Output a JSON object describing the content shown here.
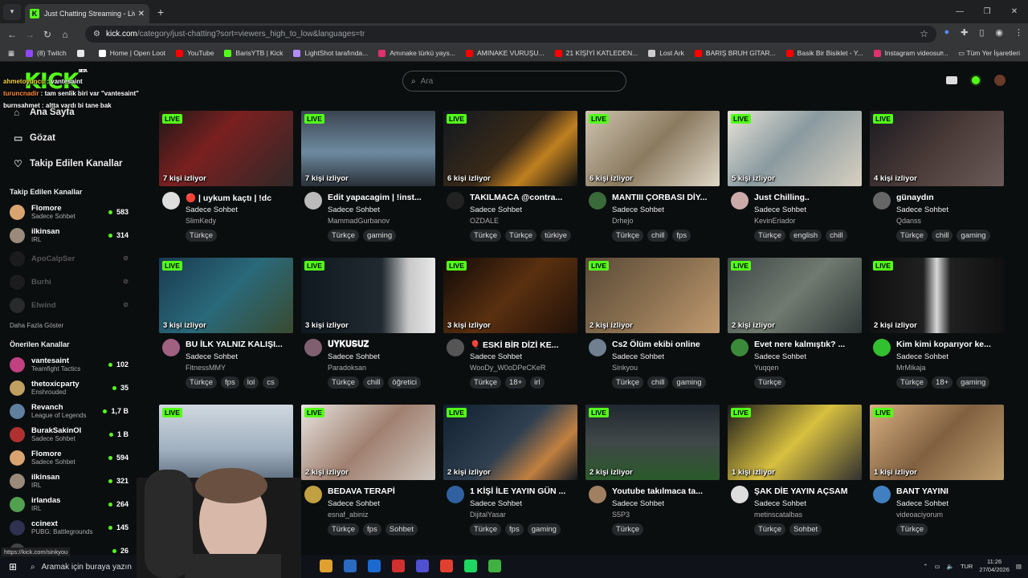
{
  "browser": {
    "tab_title": "Just Chatting Streaming - Live S",
    "url_host": "kick.com",
    "url_path": "/category/just-chatting?sort=viewers_high_to_low&languages=tr",
    "bookmarks": [
      {
        "label": "(8) Twitch",
        "color": "#9146ff"
      },
      {
        "label": "",
        "color": "#e8e8e8"
      },
      {
        "label": "Home | Open Loot",
        "color": "#ffffff"
      },
      {
        "label": "YouTube",
        "color": "#ff0000"
      },
      {
        "label": "BarisYTB | Kick",
        "color": "#53fc18"
      },
      {
        "label": "LightShot tarafında...",
        "color": "#b28cff"
      },
      {
        "label": "Amınake türkü yays...",
        "color": "#e1306c"
      },
      {
        "label": "AMINAKE VURUŞU...",
        "color": "#ff0000"
      },
      {
        "label": "21 KİŞİYİ KATLEDEN...",
        "color": "#ff0000"
      },
      {
        "label": "Lost Ark",
        "color": "#cccccc"
      },
      {
        "label": "BARIŞ BRUH GİTAR...",
        "color": "#ff0000"
      },
      {
        "label": "Basik Bir Bisiklet - Y...",
        "color": "#ff0000"
      },
      {
        "label": "Instagram videosu:...",
        "color": "#e1306c"
      }
    ],
    "all_bookmarks": "Tüm Yer İşaretleri",
    "status_link": "https://kick.com/sinkyou"
  },
  "nav": {
    "logo": "KICK",
    "logo_sup": "BETA",
    "search_placeholder": "Ara"
  },
  "chat_overlay": [
    {
      "user": "ahmetoyuncu",
      "msg": "vantesaint",
      "cls": "n1"
    },
    {
      "user": "turuncnadir",
      "msg": "tam senlik biri var \"vantesaint\"",
      "cls": "n2"
    },
    {
      "user": "burnsahmet",
      "msg": "altta vardı bi tane bak",
      "cls": "n3"
    }
  ],
  "sidebar": {
    "main": [
      {
        "icon": "⌂",
        "label": "Ana Sayfa",
        "name": "home"
      },
      {
        "icon": "▭",
        "label": "Gözat",
        "name": "browse"
      },
      {
        "icon": "♡",
        "label": "Takip Edilen Kanallar",
        "name": "following"
      }
    ],
    "followed_title": "Takip Edilen Kanallar",
    "followed": [
      {
        "name": "Flomore",
        "cat": "Sadece Sohbet",
        "viewers": "583",
        "color": "#d9a470",
        "off": false
      },
      {
        "name": "ilkinsan",
        "cat": "IRL",
        "viewers": "314",
        "color": "#9a8a7a",
        "off": false
      },
      {
        "name": "ApoCalpSer",
        "cat": "",
        "viewers": "⊘",
        "color": "#333",
        "off": true
      },
      {
        "name": "Burhi",
        "cat": "",
        "viewers": "⊘",
        "color": "#333",
        "off": true
      },
      {
        "name": "Elwind",
        "cat": "",
        "viewers": "⊘",
        "color": "#555",
        "off": true
      }
    ],
    "show_more": "Daha Fazla Göster",
    "recommended_title": "Önerilen Kanallar",
    "recommended": [
      {
        "name": "vantesaint",
        "cat": "Teamfight Tactics",
        "viewers": "102",
        "color": "#c04080"
      },
      {
        "name": "thetoxicparty",
        "cat": "Enshrouded",
        "viewers": "35",
        "color": "#c0a060"
      },
      {
        "name": "Revanch",
        "cat": "League of Legends",
        "viewers": "1,7 B",
        "color": "#6080a0"
      },
      {
        "name": "BurakSakinOl",
        "cat": "Sadece Sohbet",
        "viewers": "1 B",
        "color": "#b03030"
      },
      {
        "name": "Flomore",
        "cat": "Sadece Sohbet",
        "viewers": "594",
        "color": "#d9a470"
      },
      {
        "name": "ilkinsan",
        "cat": "IRL",
        "viewers": "321",
        "color": "#9a8a7a"
      },
      {
        "name": "irlandas",
        "cat": "IRL",
        "viewers": "264",
        "color": "#50a050"
      },
      {
        "name": "ccinext",
        "cat": "PUBG: Battlegrounds",
        "viewers": "145",
        "color": "#303050"
      },
      {
        "name": "",
        "cat": "",
        "viewers": "26",
        "color": "#444"
      }
    ]
  },
  "streams": [
    {
      "title": "🔴 | uykum kaçtı | !dc",
      "cat": "Sadece Sohbet",
      "user": "SlimKedy",
      "viewers": "7 kişi izliyor",
      "tags": [
        "Türkçe"
      ],
      "bg": "linear-gradient(135deg,#201818,#7a2020 40%,#302828)",
      "av": "#ddd"
    },
    {
      "title": "Edit yapacagim | !inst...",
      "cat": "Sadece Sohbet",
      "user": "MammadGurbanov",
      "viewers": "7 kişi izliyor",
      "tags": [
        "Türkçe",
        "gaming"
      ],
      "bg": "linear-gradient(180deg,#3a4450,#6e8aa0 55%,#2a3038)",
      "av": "#bbb"
    },
    {
      "title": "TAKILMACA @contra...",
      "cat": "Sadece Sohbet",
      "user": "OZDALE",
      "viewers": "6 kişi izliyor",
      "tags": [
        "Türkçe",
        "Türkçe",
        "türkiye"
      ],
      "bg": "linear-gradient(135deg,#101820,#3a2a18 50%,#c08020 70%,#101010)",
      "av": "#222"
    },
    {
      "title": "MANTIII ÇORBASI DİY...",
      "cat": "Sadece Sohbet",
      "user": "Drhejo",
      "viewers": "6 kişi izliyor",
      "tags": [
        "Türkçe",
        "chill",
        "fps"
      ],
      "bg": "linear-gradient(135deg,#cfc4b0,#8a7a60 50%,#e0d8c8)",
      "av": "#3a6a3a"
    },
    {
      "title": "Just Chilling..",
      "cat": "Sadece Sohbet",
      "user": "KevinEriador",
      "viewers": "5 kişi izliyor",
      "tags": [
        "Türkçe",
        "english",
        "chill"
      ],
      "bg": "linear-gradient(135deg,#e8e4d8,#8a9aa0 45%,#d8d0c0)",
      "av": "#caa"
    },
    {
      "title": "günaydın",
      "cat": "Sadece Sohbet",
      "user": "Qdanss",
      "viewers": "4 kişi izliyor",
      "tags": [
        "Türkçe",
        "chill",
        "gaming"
      ],
      "bg": "linear-gradient(135deg,#1a1a20,#4a3a38 50%,#6a5a58)",
      "av": "#666"
    },
    {
      "title": "BU İLK YALNIZ KALIŞI...",
      "cat": "Sadece Sohbet",
      "user": "FitnessMMY",
      "viewers": "3 kişi izliyor",
      "tags": [
        "Türkçe",
        "fps",
        "lol",
        "cs"
      ],
      "bg": "linear-gradient(135deg,#1a3a50,#2a6a7a 50%,#3a4a30)",
      "av": "#a06080"
    },
    {
      "title": "𝐔𝐘𝐊𝐔𝐒𝐔𝐙",
      "cat": "Sadece Sohbet",
      "user": "Paradoksan",
      "viewers": "3 kişi izliyor",
      "tags": [
        "Türkçe",
        "chill",
        "öğretici"
      ],
      "bg": "linear-gradient(90deg,#101820,#202a30 60%,#c8c8c8 80%,#e8e8e8)",
      "av": "#806070"
    },
    {
      "title": "🎈 ESKİ BİR DİZİ KE...",
      "cat": "Sadece Sohbet",
      "user": "WooDy_W0oDPeCKeR",
      "viewers": "3 kişi izliyor",
      "tags": [
        "Türkçe",
        "18+",
        "irl"
      ],
      "bg": "linear-gradient(135deg,#100a08,#5a3010 50%,#201008)",
      "av": "#555"
    },
    {
      "title": "Cs2 Ölüm ekibi online",
      "cat": "Sadece Sohbet",
      "user": "Sinkyou",
      "viewers": "2 kişi izliyor",
      "tags": [
        "Türkçe",
        "chill",
        "gaming"
      ],
      "bg": "linear-gradient(135deg,#5a4a38,#8a7050 50%,#c09a70)",
      "av": "#708090"
    },
    {
      "title": "Evet nere kalmıştık? ...",
      "cat": "Sadece Sohbet",
      "user": "Yuqqen",
      "viewers": "2 kişi izliyor",
      "tags": [
        "Türkçe"
      ],
      "bg": "linear-gradient(135deg,#404848,#707a70 50%,#303838)",
      "av": "#3a8a3a"
    },
    {
      "title": "Kim kimi koparıyor ke...",
      "cat": "Sadece Sohbet",
      "user": "MrMikaja",
      "viewers": "2 kişi izliyor",
      "tags": [
        "Türkçe",
        "18+",
        "gaming"
      ],
      "bg": "linear-gradient(90deg,#101010,#202020 40%,#d8d8d8 50%,#202020 60%,#101010)",
      "av": "#30c030"
    },
    {
      "title": "",
      "cat": "",
      "user": "",
      "viewers": "",
      "tags": [],
      "bg": "linear-gradient(180deg,#d0d8e0,#a0b0c0 60%,#607080)",
      "av": "#888"
    },
    {
      "title": "BEDAVA TERAPİ",
      "cat": "Sadece Sohbet",
      "user": "esnaf_abiniz",
      "viewers": "2 kişi izliyor",
      "tags": [
        "Türkçe",
        "fps",
        "Sohbet"
      ],
      "bg": "linear-gradient(135deg,#e8e4e0,#a08070 50%,#d0c8c0)",
      "av": "#c0a040"
    },
    {
      "title": "1 KİŞİ İLE YAYIN GÜN ...",
      "cat": "Sadece Sohbet",
      "user": "DijitalYasar",
      "viewers": "2 kişi izliyor",
      "tags": [
        "Türkçe",
        "fps",
        "gaming"
      ],
      "bg": "linear-gradient(135deg,#102030,#304050 50%,#c08040 75%,#101820)",
      "av": "#3060a0"
    },
    {
      "title": "Youtube takılmaca ta...",
      "cat": "Sadece Sohbet",
      "user": "S5P3",
      "viewers": "2 kişi izliyor",
      "tags": [
        "Türkçe"
      ],
      "bg": "linear-gradient(180deg,#202830,#404848 50%,#2a5a2a)",
      "av": "#a08060"
    },
    {
      "title": "ŞAK DİE YAYIN AÇSAM",
      "cat": "Sadece Sohbet",
      "user": "metinscatalbas",
      "viewers": "1 kişi izliyor",
      "tags": [
        "Türkçe",
        "Sohbet"
      ],
      "bg": "linear-gradient(135deg,#1a1a1a,#d8c040 50%,#303030)",
      "av": "#ddd"
    },
    {
      "title": "BANT YAYINI",
      "cat": "Sadece Sohbet",
      "user": "videoaciyorum",
      "viewers": "1 kişi izliyor",
      "tags": [
        "Türkçe"
      ],
      "bg": "linear-gradient(135deg,#d8b080,#806040 50%,#c0a070)",
      "av": "#4080c0"
    }
  ],
  "taskbar": {
    "search": "Aramak için buraya yazın",
    "lang": "TUR",
    "time": "11:26",
    "date": "27/04/2026",
    "apps": [
      "#e0a030",
      "#2a6ac0",
      "#1a6ad0",
      "#d03030",
      "#5050d0",
      "#e04030",
      "#1ed760",
      "#40b040"
    ]
  }
}
